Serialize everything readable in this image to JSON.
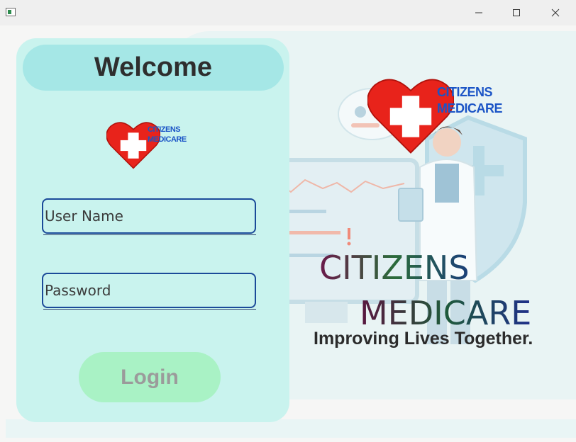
{
  "window": {
    "buttons": {
      "minimize": "minimize",
      "maximize": "maximize",
      "close": "close"
    }
  },
  "login": {
    "welcome": "Welcome",
    "username_placeholder": "User Name",
    "password_placeholder": "Password",
    "login_label": "Login"
  },
  "logo": {
    "line1": "CITIZENS",
    "line2": "MEDICARE"
  },
  "hero": {
    "brand_line1": "CITIZENS",
    "brand_line2": "MEDICARE",
    "tagline": "Improving Lives Together."
  },
  "colors": {
    "panel": "#c9f3ee",
    "welcome_pill": "#a5e7e6",
    "login_button": "#a9f2c5",
    "field_border": "#1b4a99",
    "heart_red": "#e8231b",
    "brand_blue": "#1b54c6"
  },
  "icons": [
    "window-app-icon",
    "minimize-icon",
    "maximize-icon",
    "close-icon",
    "heart-cross-logo-icon",
    "doctor-illustration"
  ]
}
